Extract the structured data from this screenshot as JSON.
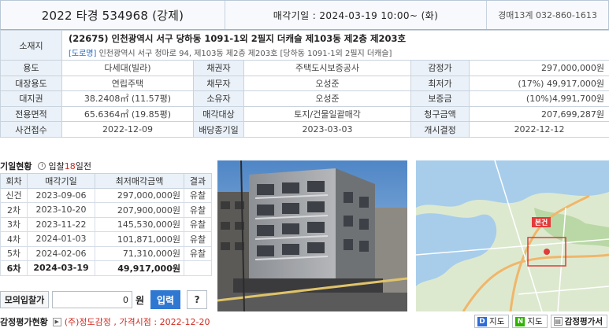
{
  "header": {
    "case_no": "2022 타경 534968 (강제)",
    "sale_date": "매각기일 : 2024-03-19 10:00~ (화)",
    "court": "경매13계 032-860-1613"
  },
  "info": {
    "address_label": "소재지",
    "address_main": "(22675) 인천광역시 서구 당하동 1091-1외 2필지 더캐슬 제103동 제2층 제203호",
    "address_tag": "[도로명]",
    "address_road": "인천광역시 서구 청마로 94, 제103동 제2층 제203호 [당하동 1091-1외 2필지 더캐슬]",
    "rows": [
      {
        "l1": "용도",
        "v1": "다세대(빌라)",
        "l2": "채권자",
        "v2": "주택도시보증공사",
        "l3": "감정가",
        "v3": "297,000,000원"
      },
      {
        "l1": "대장용도",
        "v1": "연립주택",
        "l2": "채무자",
        "v2": "오성준",
        "l3": "최저가",
        "v3": "(17%) 49,917,000원"
      },
      {
        "l1": "대지권",
        "v1": "38.2408㎡ (11.57평)",
        "l2": "소유자",
        "v2": "오성준",
        "l3": "보증금",
        "v3": "(10%)4,991,700원"
      },
      {
        "l1": "전용면적",
        "v1": "65.6364㎡ (19.85평)",
        "l2": "매각대상",
        "v2": "토지/건물일괄매각",
        "l3": "청구금액",
        "v3": "207,699,287원"
      },
      {
        "l1": "사건접수",
        "v1": "2022-12-09",
        "l2": "배당종기일",
        "v2": "2023-03-03",
        "l3": "개시결정",
        "v3": "2022-12-12"
      }
    ]
  },
  "history": {
    "title": "기일현황",
    "dday_prefix": "입찰",
    "dday_num": "18",
    "dday_suffix": "일전",
    "columns": [
      "회차",
      "매각기일",
      "최저매각금액",
      "결과"
    ],
    "rows": [
      [
        "신건",
        "2023-09-06",
        "297,000,000원",
        "유찰"
      ],
      [
        "2차",
        "2023-10-20",
        "207,900,000원",
        "유찰"
      ],
      [
        "3차",
        "2023-11-22",
        "145,530,000원",
        "유찰"
      ],
      [
        "4차",
        "2024-01-03",
        "101,871,000원",
        "유찰"
      ],
      [
        "5차",
        "2024-02-06",
        "71,310,000원",
        "유찰"
      ],
      [
        "6차",
        "2024-03-19",
        "49,917,000원",
        ""
      ]
    ]
  },
  "bid": {
    "label": "모의입찰가",
    "value": "0",
    "unit": "원",
    "submit": "입력",
    "help": "?"
  },
  "map": {
    "marker": "본건"
  },
  "appraisal": {
    "title": "감정평가현황",
    "note": "(주)정도감정 , 가격시점 : 2022-12-20"
  },
  "buttons": {
    "map1_logo": "D",
    "map1": "지도",
    "map2_logo": "N",
    "map2": "지도",
    "report": "감정평가서"
  },
  "colors": {
    "accent_red": "#d0281e",
    "accent_blue": "#2a6bc1",
    "label_bg": "#eaf1f8",
    "daum_blue": "#2d6bd8",
    "naver_green": "#2db400"
  }
}
